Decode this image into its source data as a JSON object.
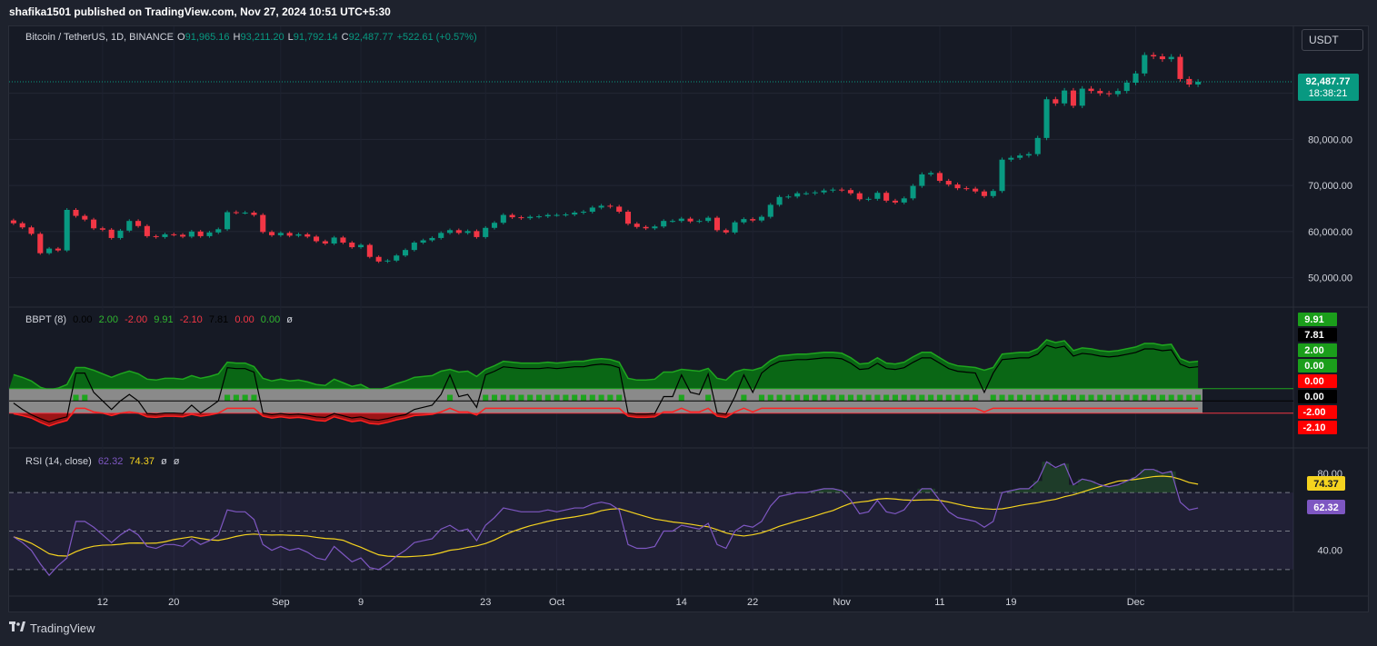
{
  "publisher": "shafika1501 published on TradingView.com, Nov 27, 2024 10:51 UTC+5:30",
  "footer_brand": "TradingView",
  "currency_button": "USDT",
  "colors": {
    "up": "#089981",
    "down": "#f23645",
    "bg": "#161a25",
    "grid": "#232735",
    "rsi_line": "#7e57c2",
    "rsi_ma": "#f5d31f",
    "bull_fill": "#0a6b14",
    "bear_fill": "#a31515"
  },
  "main_legend": {
    "symbol": "Bitcoin / TetherUS, 1D, BINANCE",
    "open_label": "O",
    "open": "91,965.16",
    "high_label": "H",
    "high": "93,211.20",
    "low_label": "L",
    "low": "91,792.14",
    "close_label": "C",
    "close": "92,487.77",
    "change": "+522.61 (+0.57%)"
  },
  "bbpt_legend": {
    "title": "BBPT (8)",
    "v1": "0.00",
    "v2": "2.00",
    "v3": "-2.00",
    "v4": "9.91",
    "v5": "-2.10",
    "v6": "7.81",
    "v7": "0.00",
    "v8": "0.00",
    "v9": "ø"
  },
  "rsi_legend": {
    "title": "RSI (14, close)",
    "rsi": "62.32",
    "ma": "74.37",
    "v3": "ø",
    "v4": "ø"
  },
  "chart_data": [
    {
      "type": "candlestick",
      "title": "Bitcoin / TetherUS, 1D, BINANCE",
      "price_axis_ticks": [
        "50,000.00",
        "60,000.00",
        "70,000.00",
        "80,000.00"
      ],
      "last_price_label": "92,487.77",
      "countdown_label": "18:38:21",
      "x_tick_labels": [
        "12",
        "20",
        "Sep",
        "9",
        "23",
        "Oct",
        "14",
        "22",
        "Nov",
        "11",
        "19",
        "Dec"
      ],
      "ylim": [
        44000,
        99000
      ],
      "closes": [
        61800,
        60900,
        59500,
        55300,
        56300,
        55900,
        64700,
        63400,
        62600,
        60700,
        60400,
        58600,
        60200,
        62300,
        61200,
        59000,
        58800,
        59400,
        59300,
        58900,
        60000,
        59000,
        59800,
        60500,
        64200,
        64100,
        64100,
        63600,
        59900,
        59200,
        59700,
        59100,
        59400,
        58900,
        57900,
        57400,
        58700,
        57600,
        56600,
        57100,
        54500,
        53500,
        53700,
        54800,
        56000,
        57600,
        58100,
        58600,
        59700,
        60300,
        59700,
        60100,
        58800,
        60800,
        61900,
        63600,
        63100,
        62900,
        63200,
        63300,
        63600,
        63600,
        63700,
        64100,
        64300,
        65200,
        65600,
        65400,
        64300,
        61700,
        61000,
        60700,
        61100,
        62300,
        62300,
        62800,
        62200,
        62300,
        63000,
        60300,
        59800,
        62000,
        62700,
        62400,
        63200,
        65800,
        67500,
        67600,
        68300,
        68300,
        68500,
        68900,
        69100,
        69000,
        68300,
        67000,
        67100,
        68400,
        66700,
        66300,
        67200,
        69900,
        72400,
        72700,
        71000,
        70200,
        69400,
        69300,
        68700,
        67700,
        68800,
        75600,
        76000,
        76500,
        76800,
        80300,
        88700,
        87800,
        90600,
        87300,
        91000,
        90500,
        90000,
        89800,
        90500,
        92300,
        94300,
        98300,
        98000,
        97400,
        97900,
        93100,
        91900,
        92500
      ]
    },
    {
      "type": "line",
      "title": "BBPT (8)",
      "scale_labels": [
        "9.91",
        "7.81",
        "2.00",
        "0.00",
        "0.00",
        "0.00",
        "-2.00",
        "-2.10"
      ],
      "ylim": [
        -6.5,
        14
      ]
    },
    {
      "type": "line",
      "title": "RSI (14, close)",
      "scale_labels": [
        "40.00",
        "80.00"
      ],
      "rsi_label": "62.32",
      "ma_label": "74.37",
      "ylim": [
        20,
        88
      ],
      "bands": [
        30,
        50,
        70
      ],
      "rsi": [
        47,
        44,
        40,
        33,
        27,
        32,
        36,
        55,
        55,
        52,
        48,
        44,
        48,
        51,
        48,
        42,
        41,
        43,
        43,
        42,
        46,
        43,
        45,
        48,
        61,
        60,
        60,
        56,
        43,
        40,
        42,
        40,
        41,
        39,
        36,
        35,
        42,
        38,
        34,
        36,
        31,
        30,
        33,
        37,
        40,
        44,
        45,
        46,
        51,
        53,
        50,
        51,
        45,
        53,
        57,
        62,
        61,
        60,
        60,
        60,
        61,
        60,
        61,
        62,
        62,
        64,
        65,
        64,
        61,
        43,
        41,
        41,
        42,
        50,
        50,
        53,
        52,
        51,
        54,
        43,
        41,
        50,
        53,
        52,
        55,
        63,
        68,
        69,
        70,
        70,
        71,
        72,
        72,
        71,
        66,
        59,
        60,
        66,
        60,
        59,
        61,
        67,
        72,
        72,
        66,
        60,
        57,
        56,
        55,
        52,
        55,
        70,
        71,
        72,
        72,
        76,
        86,
        83,
        85,
        74,
        77,
        76,
        74,
        73,
        74,
        76,
        78,
        82,
        82,
        80,
        81,
        65,
        61,
        62
      ]
    }
  ]
}
